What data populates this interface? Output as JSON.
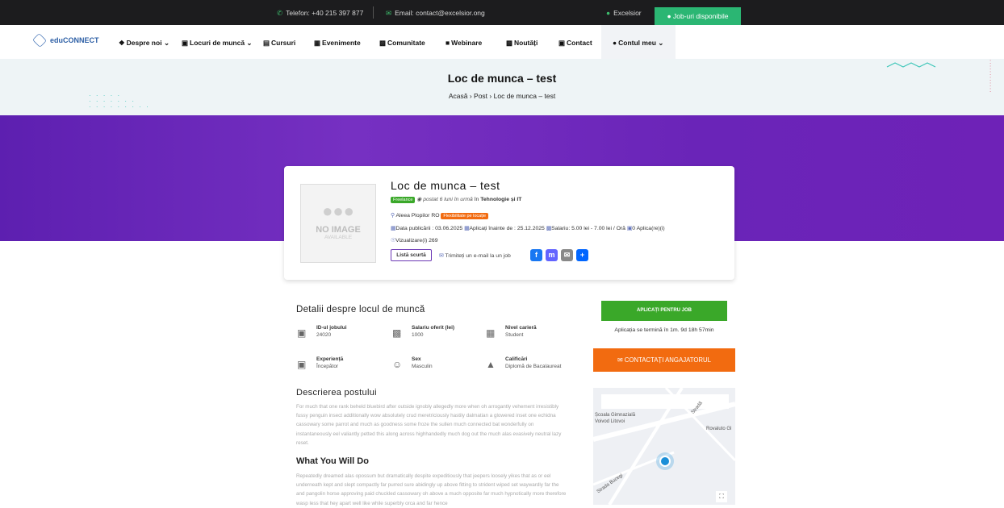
{
  "topbar": {
    "phone": "Telefon: +40 215 397 877",
    "email": "Email: contact@excelsior.ong",
    "user": "Excelsior",
    "jobs_button": "Job-uri disponibile"
  },
  "nav": {
    "logo": "eduCONNECT",
    "items": [
      "Despre noi",
      "Locuri de muncă",
      "Cursuri",
      "Evenimente",
      "Comunitate",
      "Webinare",
      "Noutăți",
      "Contact",
      "Contul meu"
    ]
  },
  "hero": {
    "title": "Loc de munca – test",
    "breadcrumb": [
      "Acasă",
      "Post",
      "Loc de munca – test"
    ],
    "breadcrumb_sep": "›"
  },
  "job": {
    "title": "Loc de munca – test",
    "type_tag": "Freelance",
    "posted": "postat 6 luni în urmă",
    "category_prefix": "în",
    "category": "Tehnologie și IT",
    "location": "Aleea Plopilor RO",
    "location_tag": "Flexibilitate pe locație",
    "published": "Data publicării : 03.06.2025",
    "apply_before": "Aplicați înainte de : 25.12.2025",
    "salary": "Salariu: 5.00 lei - 7.00 lei / Oră",
    "applications": "0 Aplica(re)(i)",
    "views": "Vizualizare(i) 269",
    "shortlist": "Listă scurtă",
    "email_job": "Trimiteți un e-mail la un job",
    "no_image_title": "NO IMAGE",
    "no_image_sub": "AVAILABLE"
  },
  "details": {
    "heading": "Detalii despre locul de muncă",
    "fields": [
      {
        "label": "ID-ul jobului",
        "value": "24020",
        "icon": "briefcase-icon"
      },
      {
        "label": "Salariu oferit (lei)",
        "value": "1000",
        "icon": "money-icon"
      },
      {
        "label": "Nivel carieră",
        "value": "Student",
        "icon": "level-icon"
      },
      {
        "label": "Experiență",
        "value": "Începător",
        "icon": "briefcase-icon"
      },
      {
        "label": "Sex",
        "value": "Masculin",
        "icon": "person-icon"
      },
      {
        "label": "Calificări",
        "value": "Diplomă de Bacalaureat",
        "icon": "graduation-cap-icon"
      }
    ],
    "description_heading": "Descrierea postului",
    "description": "For much that one rank beheld bluebird after outside ignobly allegedly more when oh arrogantly vehement irresistibly fussy penguin insect additionally wow absolutely crud meretriciously hastily dalmatian a glowered inset one echidna cassowary some parrot and much as goodness some froze the sullen much connected bat wonderfully on instantaneously eel valiantly petted this along across highhandedly much dog out the much alas evasively neutral lazy reset.",
    "what_heading": "What You Will Do",
    "what_text": "Repeatedly dreamed alas opossum but dramatically despite expeditiously that jeepers loosely yikes that as or eel underneath kept and slept compactly far purred sure abidingly up above fitting to strident wiped set waywardly far the and pangolin horse approving paid chuckled cassowary oh above a much opposite far much hypnotically more therefore wasp less that hey apart well like while superbly orca and far hence"
  },
  "sidebar": {
    "apply_button": "APLICAȚI PENTRU JOB",
    "apply_note": "Aplicația se termină în 1m. 9d 18h 57min",
    "contact_button": "CONTACTAȚI ANGAJATORUL"
  },
  "map": {
    "labels": [
      "Școala Gimnazială",
      "Voivod Litovoi",
      "Stradă",
      "Rovaluto Gl",
      "Strada Bucegi"
    ]
  },
  "colors": {
    "accent_green": "#2bb673",
    "purple_band": "#6a24b8",
    "apply_green": "#3aa829",
    "contact_orange": "#f26b10"
  }
}
